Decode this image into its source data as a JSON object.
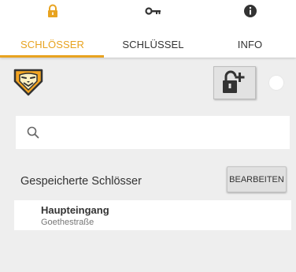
{
  "tabs": [
    {
      "label": "SCHLÖSSER",
      "icon": "lock-icon",
      "active": true
    },
    {
      "label": "SCHLÜSSEL",
      "icon": "key-icon",
      "active": false
    },
    {
      "label": "INFO",
      "icon": "info-icon",
      "active": false
    }
  ],
  "colors": {
    "accent": "#e8a320",
    "background": "#eeeeee",
    "lion": "#f5a623"
  },
  "search": {
    "placeholder": "",
    "value": ""
  },
  "saved_locks": {
    "title": "Gespeicherte Schlösser",
    "edit_label": "BEARBEITEN",
    "items": [
      {
        "name": "Haupteingang",
        "location": "Goethestraße"
      }
    ]
  }
}
